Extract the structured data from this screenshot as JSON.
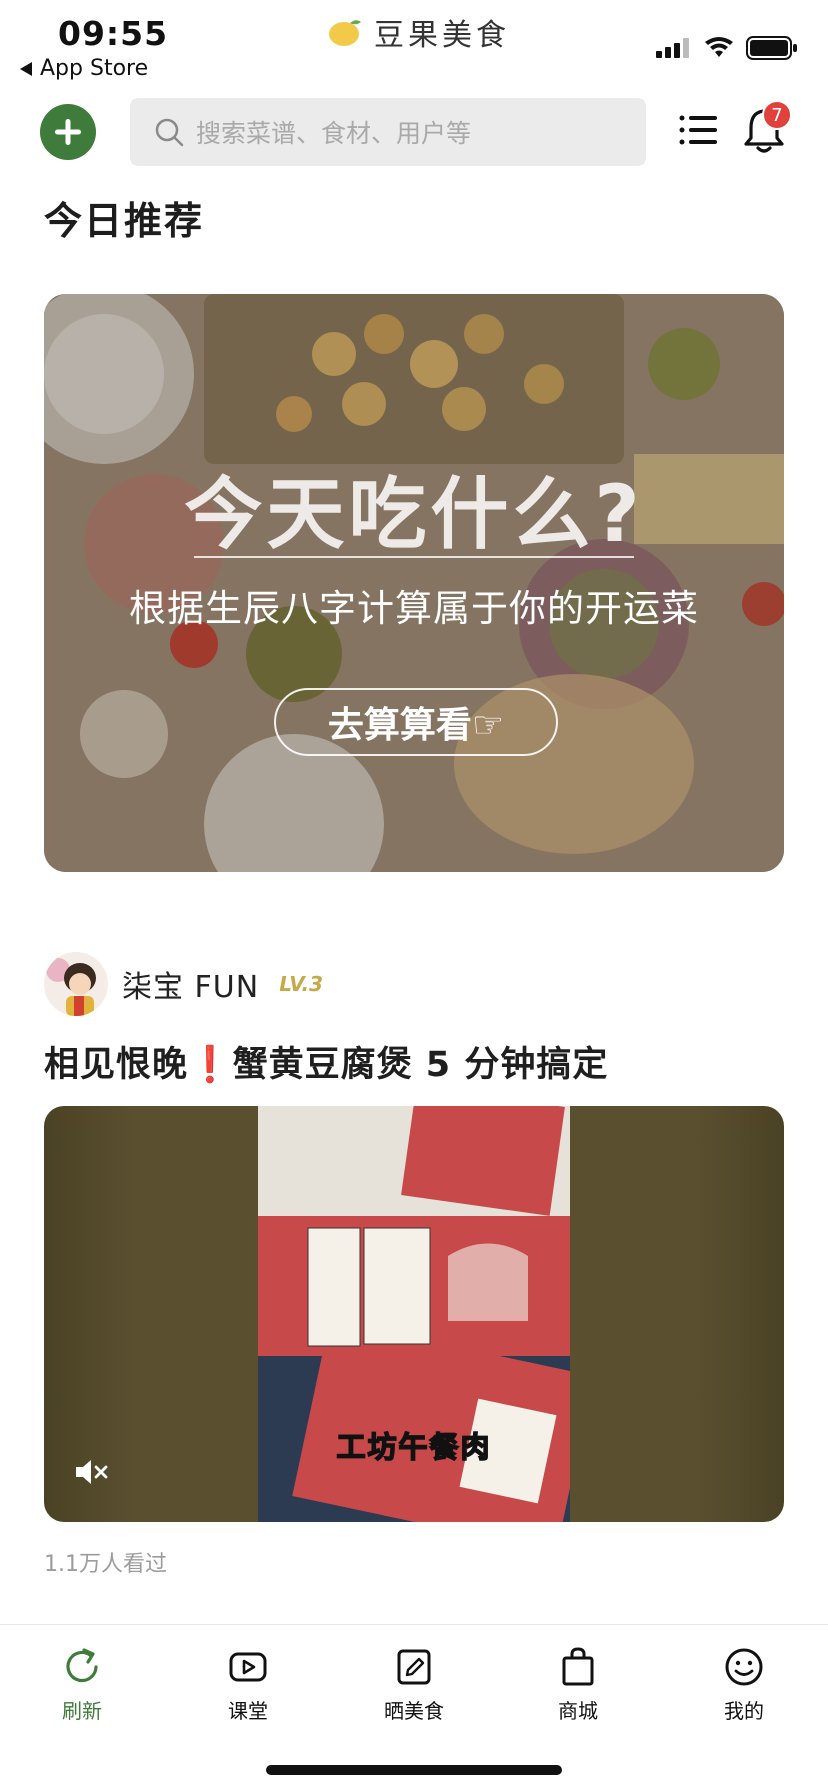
{
  "status_bar": {
    "time": "09:55",
    "back_label": "App Store"
  },
  "app": {
    "name": "豆果美食",
    "brand_color": "#f3c94a"
  },
  "header": {
    "search_placeholder": "搜索菜谱、食材、用户等",
    "notification_count": "7",
    "accent_color": "#3f7b3a",
    "badge_color": "#e0413c"
  },
  "section": {
    "title": "今日推荐"
  },
  "banner": {
    "title": "今天吃什么?",
    "subtitle": "根据生辰八字计算属于你的开运菜",
    "button_label": "去算算看☞"
  },
  "post": {
    "author_name": "柒宝 FUN",
    "author_level": "LV.3",
    "title_part1": "相见恨晚",
    "title_mark": "❗",
    "title_part2": "蟹黄豆腐煲 5 分钟搞定",
    "video_caption": "工坊午餐肉",
    "view_count": "1.1万人看过"
  },
  "tabbar": {
    "items": [
      {
        "label": "刷新",
        "icon": "refresh-icon",
        "active": true
      },
      {
        "label": "课堂",
        "icon": "play-icon",
        "active": false
      },
      {
        "label": "晒美食",
        "icon": "edit-icon",
        "active": false
      },
      {
        "label": "商城",
        "icon": "bag-icon",
        "active": false
      },
      {
        "label": "我的",
        "icon": "smiley-icon",
        "active": false
      }
    ]
  }
}
